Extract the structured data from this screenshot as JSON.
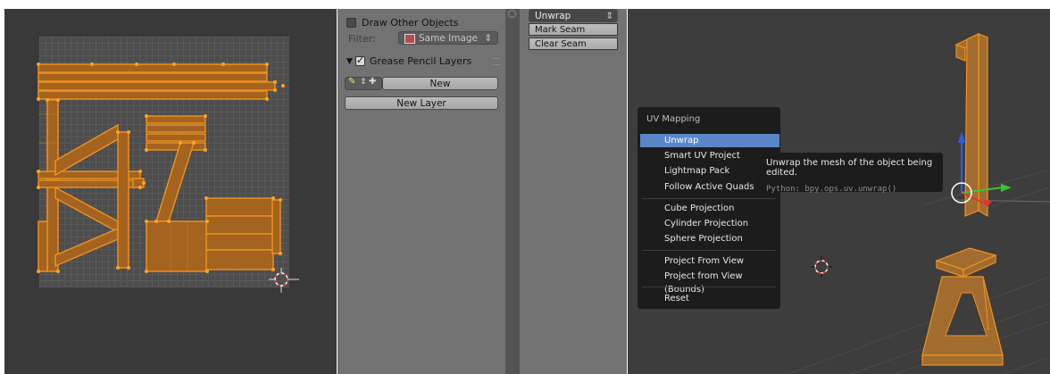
{
  "tool_panel": {
    "draw_other_objects": "Draw Other Objects",
    "filter_label": "Filter:",
    "filter_value": "Same Image",
    "grease_pencil_layers": "Grease Pencil Layers",
    "new_button": "New",
    "new_layer_button": "New Layer"
  },
  "tool_shelf": {
    "unwrap_dropdown": "Unwrap",
    "mark_seam": "Mark Seam",
    "clear_seam": "Clear Seam"
  },
  "uv_menu": {
    "title": "UV Mapping",
    "items": [
      "Unwrap",
      "Smart UV Project",
      "Lightmap Pack",
      "Follow Active Quads",
      "Cube Projection",
      "Cylinder Projection",
      "Sphere Projection",
      "Project From View",
      "Project from View (Bounds)",
      "Reset"
    ]
  },
  "tooltip": {
    "text": "Unwrap the mesh of the object being edited.",
    "python": "Python: bpy.ops.uv.unwrap()"
  },
  "colors": {
    "uv_orange": "#e8881c",
    "menu_highlight": "#5a86c8",
    "axis_blue": "#2f5ee8",
    "axis_red": "#e83030",
    "axis_green": "#3ac23a"
  }
}
